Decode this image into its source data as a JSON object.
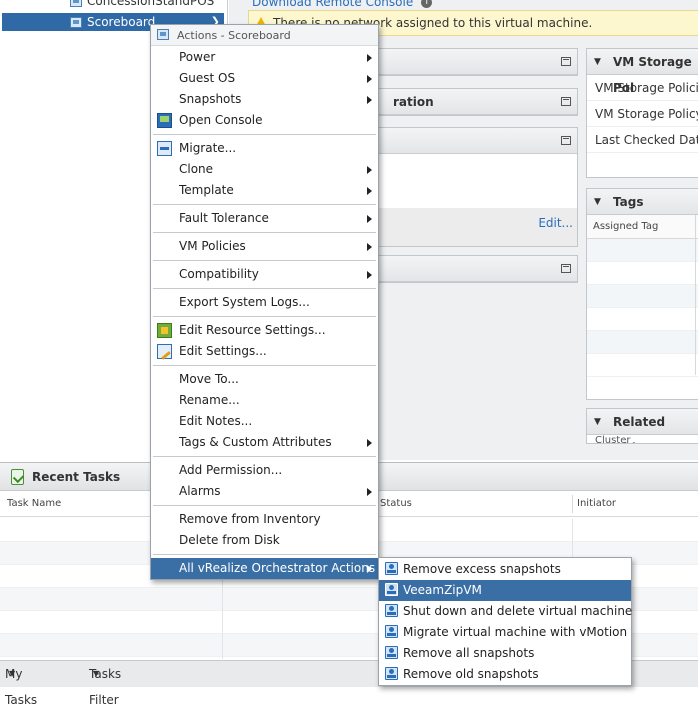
{
  "tree": {
    "item_above": "ConcessionStandPOS",
    "selected_item": "Scoreboard"
  },
  "header": {
    "remote_console_link": "Download Remote Console",
    "info_glyph": "i",
    "warning": "There is no network assigned to this virtual machine."
  },
  "portlets": {
    "vm_hardware_title": "",
    "configuration_title": "ration",
    "edit_link": "Edit..."
  },
  "vm_storage": {
    "title": "VM Storage Pol",
    "rows": [
      "VM Storage Policie",
      "VM Storage Policy C",
      "Last Checked Date"
    ]
  },
  "tags": {
    "title": "Tags",
    "column": "Assigned Tag"
  },
  "related": {
    "title": "Related Objects",
    "row_cluster": "Cluster"
  },
  "menu": {
    "title": "Actions - Scoreboard",
    "items": [
      {
        "label": "Power"
      },
      {
        "label": "Guest OS"
      },
      {
        "label": "Snapshots"
      },
      {
        "label": "Open Console"
      },
      {
        "label": "Migrate..."
      },
      {
        "label": "Clone"
      },
      {
        "label": "Template"
      },
      {
        "label": "Fault Tolerance"
      },
      {
        "label": "VM Policies"
      },
      {
        "label": "Compatibility"
      },
      {
        "label": "Export System Logs..."
      },
      {
        "label": "Edit Resource Settings..."
      },
      {
        "label": "Edit Settings..."
      },
      {
        "label": "Move To..."
      },
      {
        "label": "Rename..."
      },
      {
        "label": "Edit Notes..."
      },
      {
        "label": "Tags & Custom Attributes"
      },
      {
        "label": "Add Permission..."
      },
      {
        "label": "Alarms"
      },
      {
        "label": "Remove from Inventory"
      },
      {
        "label": "Delete from Disk"
      },
      {
        "label": "All vRealize Orchestrator Actions"
      }
    ]
  },
  "submenu": {
    "items": [
      {
        "label": "Remove excess snapshots"
      },
      {
        "label": "VeeamZipVM"
      },
      {
        "label": "Shut down and delete virtual machine"
      },
      {
        "label": "Migrate virtual machine with vMotion"
      },
      {
        "label": "Remove all snapshots"
      },
      {
        "label": "Remove old snapshots"
      }
    ]
  },
  "recent_tasks": {
    "title": "Recent Tasks",
    "columns": [
      "Task Name",
      "Status",
      "Initiator"
    ],
    "footer_my_tasks": "My Tasks",
    "footer_tasks_filter": "Tasks Filter"
  },
  "colors": {
    "selection": "#3a6fa6",
    "link": "#2a6ebb",
    "warning_bg": "#fdf7cf"
  }
}
